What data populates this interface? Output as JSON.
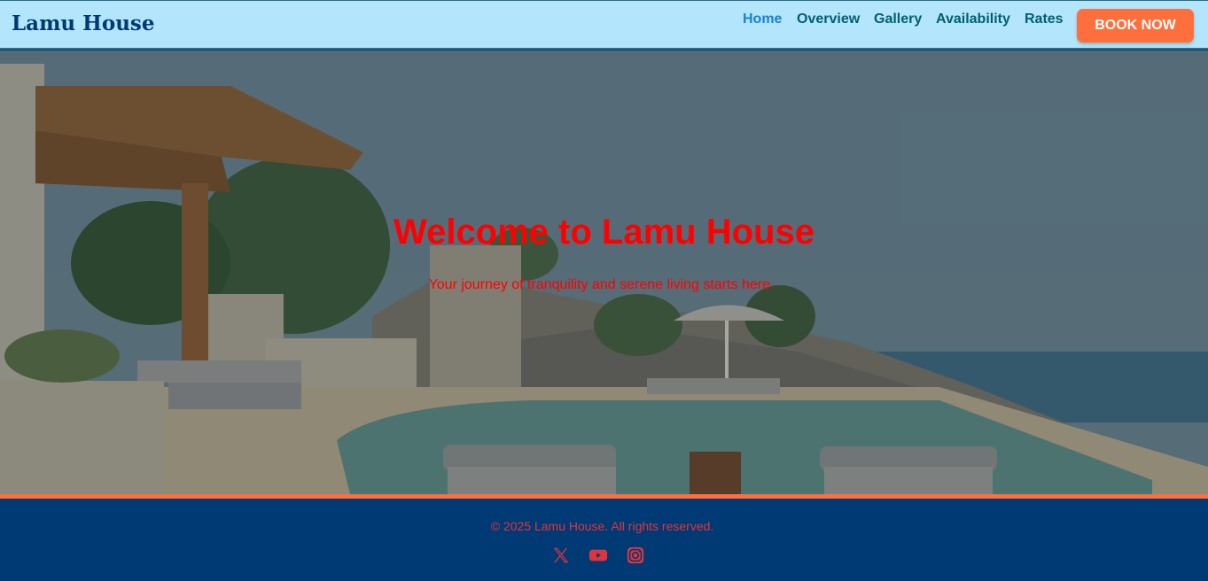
{
  "header": {
    "brand": "Lamu House",
    "nav": [
      {
        "label": "Home",
        "active": true
      },
      {
        "label": "Overview",
        "active": false
      },
      {
        "label": "Gallery",
        "active": false
      },
      {
        "label": "Availability",
        "active": false
      },
      {
        "label": "Rates",
        "active": false
      }
    ],
    "book_label": "BOOK NOW"
  },
  "hero": {
    "title": "Welcome to Lamu House",
    "subtitle": "Your journey of tranquility and serene living starts here."
  },
  "footer": {
    "copyright": "© 2025 Lamu House. All rights reserved.",
    "social_icons": [
      "x-icon",
      "youtube-icon",
      "instagram-icon"
    ]
  },
  "colors": {
    "header_bg": "#b3e5fc",
    "brand_text": "#003a75",
    "nav_text": "#00606e",
    "nav_active": "#1a7fd6",
    "button_bg": "#ff6f3c",
    "hero_text": "#ff0000",
    "footer_bg": "#003a75",
    "footer_text": "#e0343c"
  }
}
